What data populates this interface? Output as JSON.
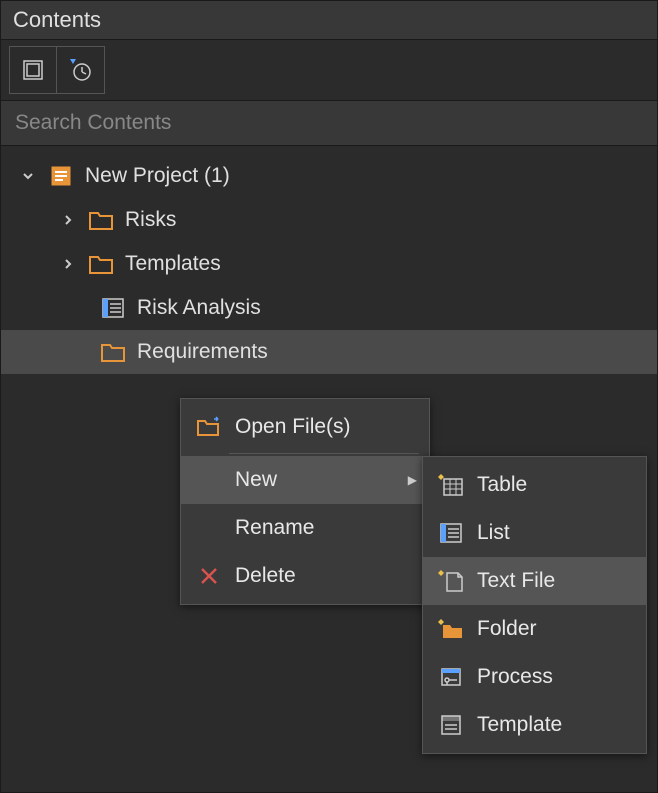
{
  "panel": {
    "title": "Contents",
    "search_placeholder": "Search Contents"
  },
  "tree": {
    "root": "New Project (1)",
    "items": [
      {
        "label": "Risks"
      },
      {
        "label": "Templates"
      },
      {
        "label": "Risk Analysis"
      },
      {
        "label": "Requirements"
      }
    ]
  },
  "context_menu": {
    "open_files": "Open File(s)",
    "new": "New",
    "rename": "Rename",
    "delete": "Delete"
  },
  "new_submenu": {
    "table": "Table",
    "list": "List",
    "text_file": "Text File",
    "folder": "Folder",
    "process": "Process",
    "template": "Template"
  }
}
